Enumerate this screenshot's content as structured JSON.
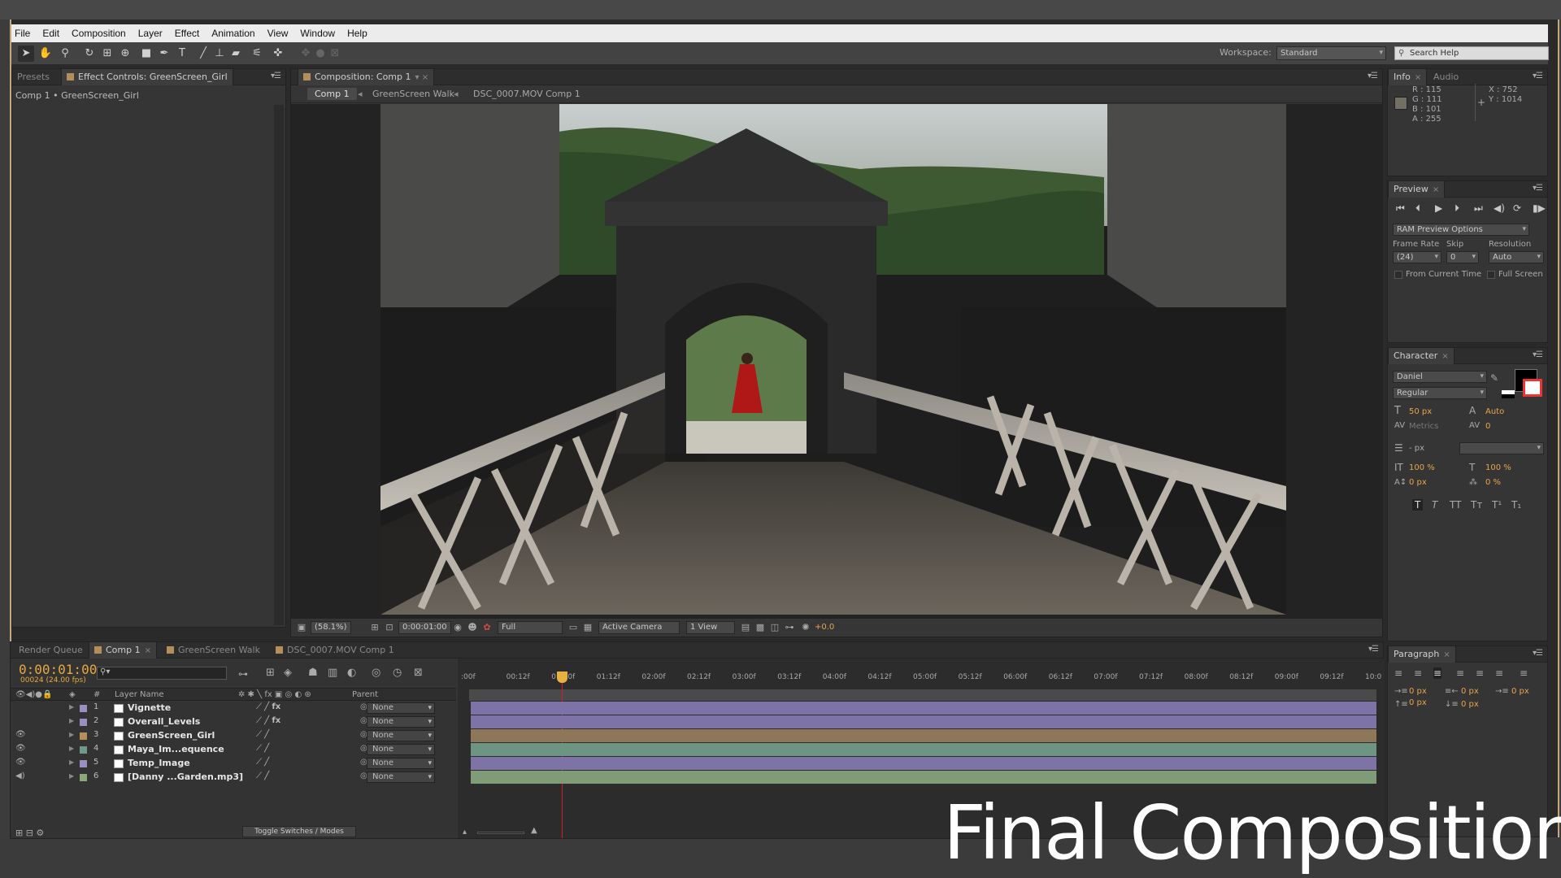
{
  "menu": [
    "File",
    "Edit",
    "Composition",
    "Layer",
    "Effect",
    "Animation",
    "View",
    "Window",
    "Help"
  ],
  "workspace": {
    "label": "Workspace:",
    "value": "Standard"
  },
  "search": {
    "placeholder": "Search Help"
  },
  "left_panel": {
    "tab_presets": "Presets",
    "tab_effect": "Effect Controls: GreenScreen_Girl",
    "breadcrumb": "Comp 1 • GreenScreen_Girl"
  },
  "viewer": {
    "tab": "Composition: Comp 1",
    "crumbs": [
      "Comp 1",
      "GreenScreen Walk",
      "DSC_0007.MOV Comp 1"
    ],
    "zoom": "(58.1%)",
    "timecode": "0:00:01:00",
    "resolution": "Full",
    "camera": "Active Camera",
    "views": "1 View",
    "exposure": "+0.0"
  },
  "info": {
    "tab": "Info",
    "tab2": "Audio",
    "r": "R : 115",
    "g": "G : 111",
    "b": "B : 101",
    "a": "A : 255",
    "x": "X : 752",
    "y": "Y : 1014",
    "swatch": "#736f65"
  },
  "preview": {
    "tab": "Preview",
    "ram_options": "RAM Preview Options",
    "frame_rate_label": "Frame Rate",
    "skip_label": "Skip",
    "resolution_label": "Resolution",
    "frame_rate": "(24)",
    "skip": "0",
    "resolution": "Auto",
    "from_current": "From Current Time",
    "full_screen": "Full Screen"
  },
  "character": {
    "tab": "Character",
    "font": "Daniel",
    "style": "Regular",
    "size": "50 px",
    "leading": "Auto",
    "kerning": "Metrics",
    "tracking": "0",
    "stroke": "- px",
    "vscale": "100 %",
    "hscale": "100 %",
    "baseline": "0 px",
    "tsume": "0 %"
  },
  "paragraph": {
    "tab": "Paragraph",
    "indent_left": "0 px",
    "indent_right": "0 px",
    "indent_first": "0 px",
    "space_before": "0 px",
    "space_after": "0 px"
  },
  "timeline": {
    "tabs": [
      "Render Queue",
      "Comp 1",
      "GreenScreen Walk",
      "DSC_0007.MOV Comp 1"
    ],
    "timecode": "0:00:01:00",
    "frames": "00024 (24.00 fps)",
    "col_layer_name": "Layer Name",
    "col_parent": "Parent",
    "col_num": "#",
    "toggle": "Toggle Switches / Modes",
    "ruler": [
      ":00f",
      "00:12f",
      "01:00f",
      "01:12f",
      "02:00f",
      "02:12f",
      "03:00f",
      "03:12f",
      "04:00f",
      "04:12f",
      "05:00f",
      "05:12f",
      "06:00f",
      "06:12f",
      "07:00f",
      "07:12f",
      "08:00f",
      "08:12f",
      "09:00f",
      "09:12f",
      "10:0"
    ],
    "layers": [
      {
        "num": "1",
        "name": "Vignette",
        "label": "#9a8fc0",
        "parent": "None",
        "bar": "#7d73a6",
        "fx": "fx"
      },
      {
        "num": "2",
        "name": "Overall_Levels",
        "label": "#9a8fc0",
        "parent": "None",
        "bar": "#7d73a6",
        "fx": "fx"
      },
      {
        "num": "3",
        "name": "GreenScreen_Girl",
        "label": "#b58f5a",
        "parent": "None",
        "bar": "#8e7658",
        "fx": ""
      },
      {
        "num": "4",
        "name": "Maya_Im...equence",
        "label": "#6f9a8a",
        "parent": "None",
        "bar": "#6e9484",
        "fx": ""
      },
      {
        "num": "5",
        "name": "Temp_Image",
        "label": "#9a8fc0",
        "parent": "None",
        "bar": "#7d73a6",
        "fx": ""
      },
      {
        "num": "6",
        "name": "[Danny ...Garden.mp3]",
        "label": "#8aa878",
        "parent": "None",
        "bar": "#7f9c76",
        "fx": ""
      }
    ]
  },
  "overlay_title": "Final Composition"
}
